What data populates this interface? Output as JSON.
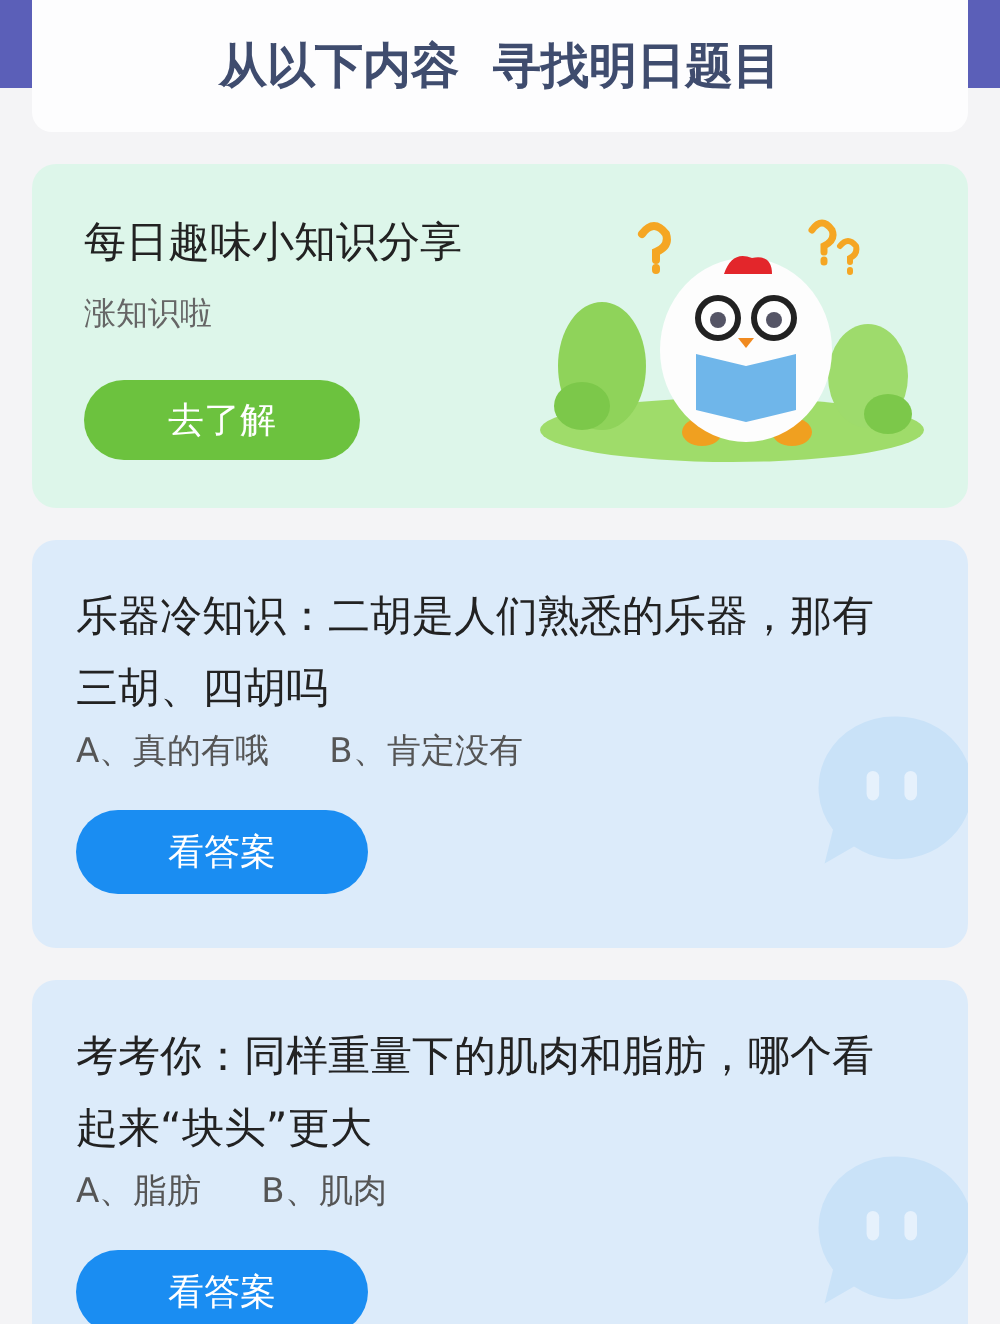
{
  "header": {
    "title": "从以下内容  寻找明日题目"
  },
  "promo": {
    "title": "每日趣味小知识分享",
    "subtitle": "涨知识啦",
    "button": "去了解"
  },
  "questions": [
    {
      "question": "乐器冷知识：二胡是人们熟悉的乐器，那有三胡、四胡吗",
      "options": [
        "A、真的有哦",
        "B、肯定没有"
      ],
      "button": "看答案"
    },
    {
      "question": "考考你：同样重量下的肌肉和脂肪，哪个看起来“块头”更大",
      "options": [
        "A、脂肪",
        "B、肌肉"
      ],
      "button": "看答案"
    }
  ]
}
